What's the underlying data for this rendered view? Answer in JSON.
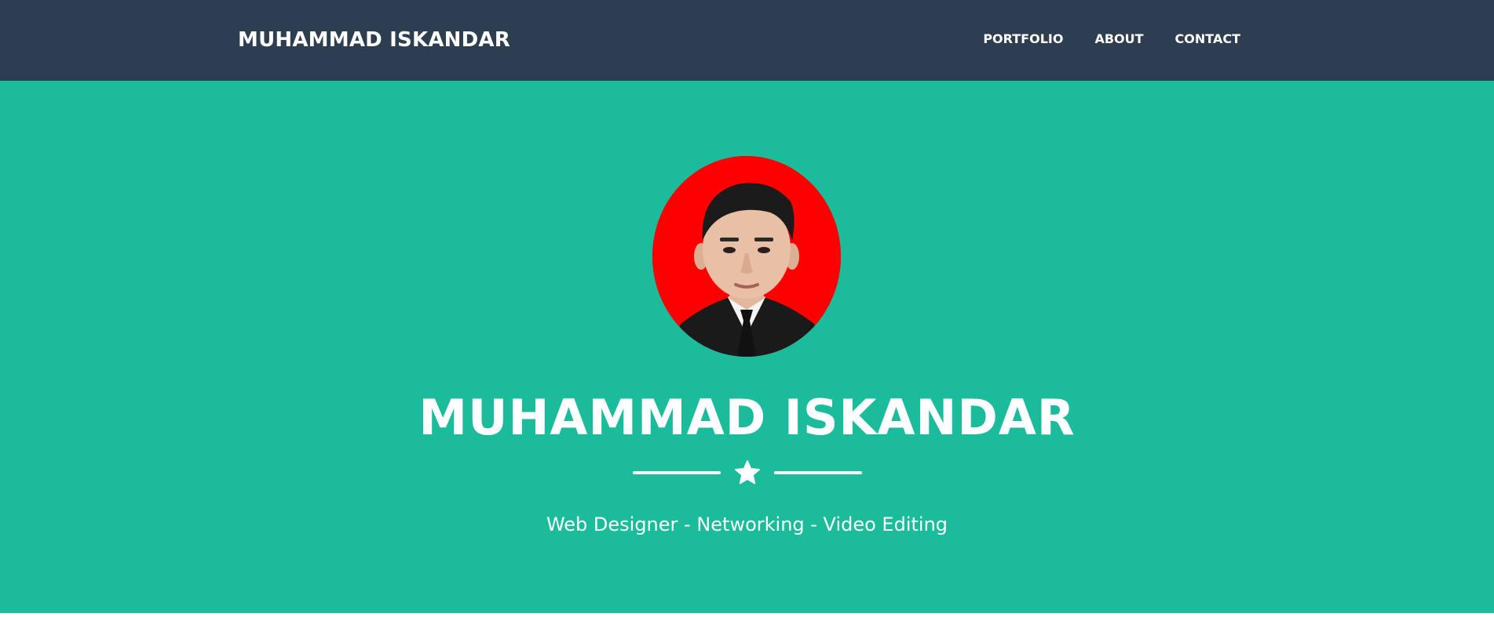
{
  "navbar": {
    "brand": "MUHAMMAD ISKANDAR",
    "links": [
      "PORTFOLIO",
      "ABOUT",
      "CONTACT"
    ],
    "background": "#2c3e50"
  },
  "hero": {
    "title": "MUHAMMAD ISKANDAR",
    "subtitle": "Web Designer - Networking - Video Editing",
    "background": "#1abc9c",
    "divider_icon": "star-icon",
    "avatar": {
      "icon": "profile-photo",
      "background": "#ff0000"
    }
  }
}
